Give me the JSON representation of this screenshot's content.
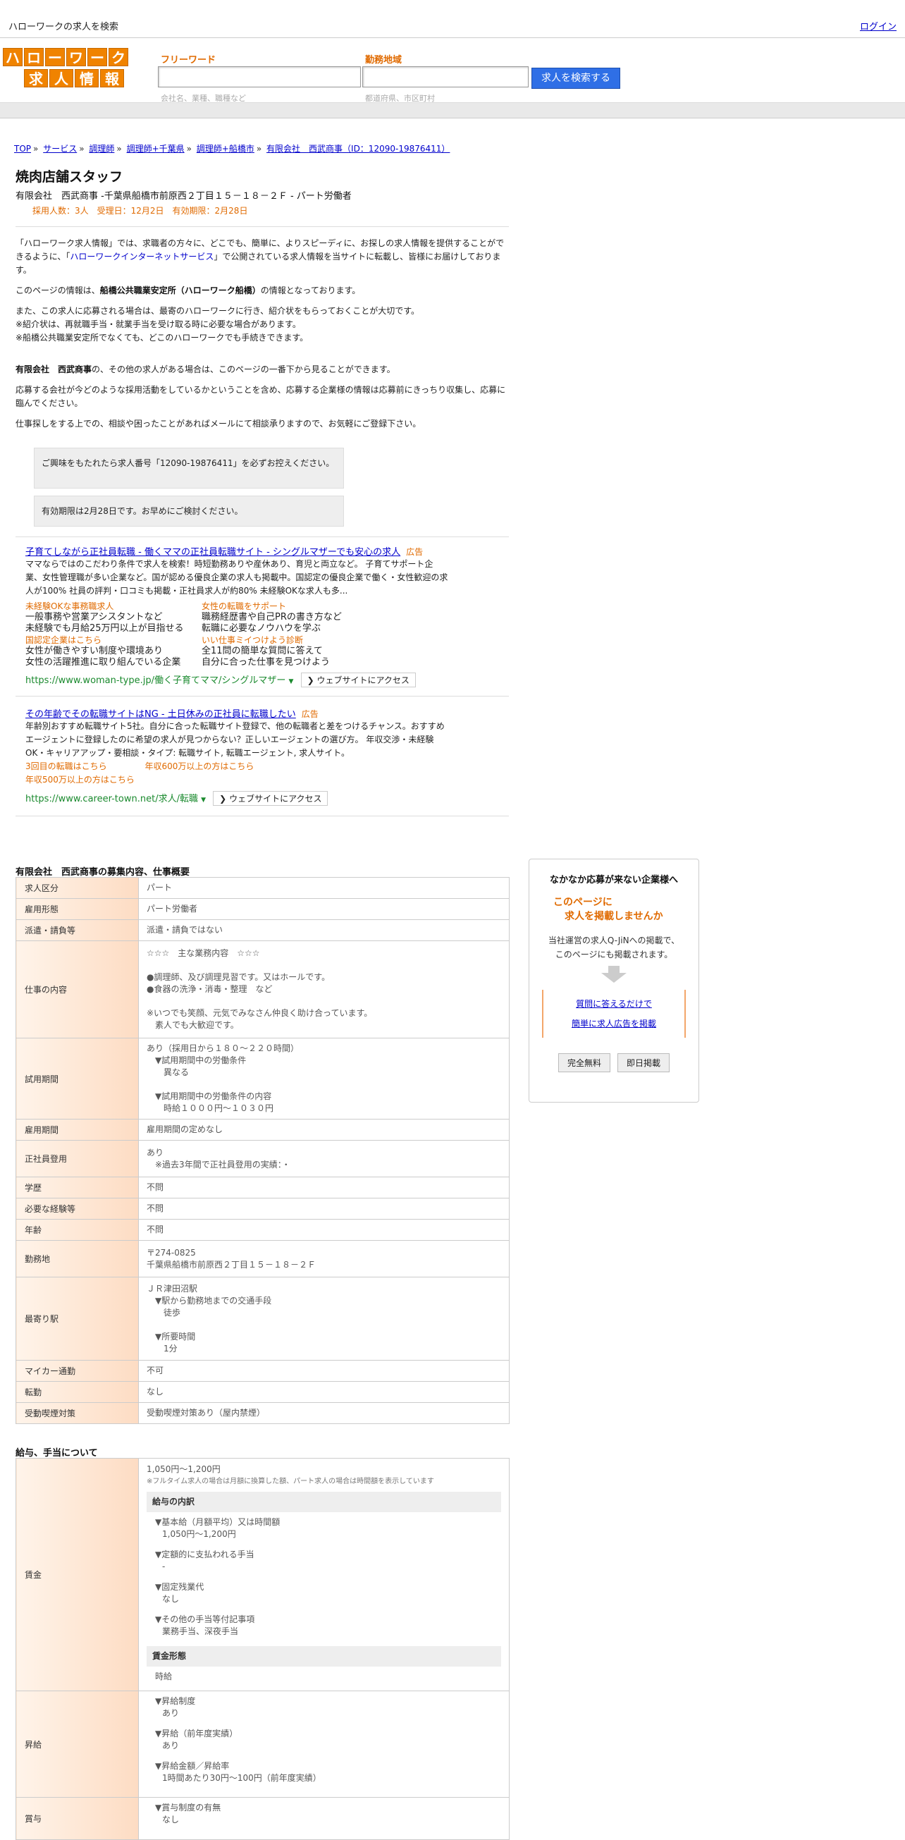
{
  "topbar": {
    "site_title": "ハローワークの求人を検索",
    "login": "ログイン"
  },
  "logo": {
    "row1": [
      "ハ",
      "ロ",
      "ー",
      "ワ",
      "ー",
      "ク"
    ],
    "row2": [
      "求",
      "人",
      "情",
      "報"
    ]
  },
  "search": {
    "free_label": "フリーワード",
    "free_placeholder": "会社名、業種、職種など",
    "area_label": "勤務地域",
    "area_placeholder": "都道府県、市区町村",
    "button": "求人を検索する"
  },
  "breadcrumb": [
    "TOP",
    "サービス",
    "調理師",
    "調理師+千葉県",
    "調理師+船橋市",
    "有限会社　西武商事（ID：12090-19876411）"
  ],
  "job": {
    "title": "焼肉店舗スタッフ",
    "subtitle": "有限会社　西武商事 -千葉県船橋市前原西２丁目１５－１８－２Ｆ - パート労働者",
    "meta": "採用人数：3人　受理日：12月2日　有効期限：2月28日"
  },
  "intro": {
    "p1a": "「ハローワーク求人情報」では、求職者の方々に、どこでも、簡単に、よりスピーディに、お探しの求人情報を提供することができるように、「",
    "p1link": "ハローワークインターネットサービス",
    "p1b": "」で公開されている求人情報を当サイトに転載し、皆様にお届けしております。",
    "p2a": "このページの情報は、",
    "p2b": "船橋公共職業安定所（ハローワーク船橋）",
    "p2c": "の情報となっております。",
    "p3": [
      "また、この求人に応募される場合は、最寄のハローワークに行き、紹介状をもらっておくことが大切です。",
      "※紹介状は、再就職手当・就業手当を受け取る時に必要な場合があります。",
      "※船橋公共職業安定所でなくても、どこのハローワークでも手続きできます。"
    ],
    "p4a": "有限会社　西武商事",
    "p4b": "の、その他の求人がある場合は、このページの一番下から見ることができます。",
    "p5": "応募する会社が今どのような採用活動をしているかということを含め、応募する企業様の情報は応募前にきっちり収集し、応募に臨んでください。",
    "p6": "仕事探しをする上での、相談や困ったことがあればメールにて相談承りますので、お気軽にご登録下さい。",
    "notice1": "ご興味をもたれたら求人番号「12090-19876411」を必ずお控えください。",
    "notice2": "有効期限は2月28日です。お早めにご検討ください。"
  },
  "ads": [
    {
      "title": "子育てしながら正社員転職 - 働くママの正社員転職サイト - シングルマザーでも安心の求人",
      "tag": "広告",
      "desc": "ママならではのこだわり条件で求人を検索！時短勤務ありや産休あり、育児と両立など。 子育てサポート企業、女性管理職が多い企業など。国が認める優良企業の求人も掲載中。国認定の優良企業で働く・女性歓迎の求人が100% 社員の評判・口コミも掲載・正社員求人が約80% 未経験OKな求人も多...",
      "links": [
        {
          "t": "未経験OKな事務職求人",
          "l1": "一般事務や営業アシスタントなど",
          "l2": "未経験でも月給25万円以上が目指せる"
        },
        {
          "t": "女性の転職をサポート",
          "l1": "職務経歴書や自己PRの書き方など",
          "l2": "転職に必要なノウハウを学ぶ"
        },
        {
          "t": "国認定企業はこちら",
          "l1": "女性が働きやすい制度や環境あり",
          "l2": "女性の活躍推進に取り組んでいる企業"
        },
        {
          "t": "いい仕事ミイつけよう診断",
          "l1": "全11問の簡単な質問に答えて",
          "l2": "自分に合った仕事を見つけよう"
        }
      ],
      "url": "https://www.woman-type.jp/働く子育てママ/シングルマザー",
      "visit": "ウェブサイトにアクセス"
    },
    {
      "title": "その年齢でその転職サイトはNG - 土日休みの正社員に転職したい",
      "tag": "広告",
      "desc": "年齢別おすすめ転職サイト5社。自分に合った転職サイト登録で、他の転職者と差をつけるチャンス。おすすめエージェントに登録したのに希望の求人が見つからない？正しいエージェントの選び方。 年収交渉・未経験OK・キャリアアップ・要相談・タイプ: 転職サイト, 転職エージェント, 求人サイト。",
      "orange": [
        "3回目の転職はこちら",
        "年収600万以上の方はこちら",
        "年収500万以上の方はこちら"
      ],
      "url": "https://www.career-town.net/求人/転職",
      "visit": "ウェブサイトにアクセス"
    }
  ],
  "table1": {
    "title": "有限会社　西武商事の募集内容、仕事概要",
    "rows": [
      {
        "k": "求人区分",
        "v": "パート"
      },
      {
        "k": "雇用形態",
        "v": "パート労働者"
      },
      {
        "k": "派遣・請負等",
        "v": "派遣・請負ではない"
      },
      {
        "k": "仕事の内容",
        "lines": [
          "☆☆☆　主な業務内容　☆☆☆",
          "",
          "●調理師、及び調理見習です。又はホールです。",
          "●食器の洗浄・消毒・整理　など",
          "",
          "※いつでも笑顔、元気でみなさん仲良く助け合っています。",
          "　素人でも大歓迎です。"
        ]
      },
      {
        "k": "試用期間",
        "lines": [
          "あり（採用日から１８０～２２０時間）",
          "　▼試用期間中の労働条件",
          "　　異なる",
          "",
          "　▼試用期間中の労働条件の内容",
          "　　時給１０００円～１０３０円"
        ]
      },
      {
        "k": "雇用期間",
        "v": "雇用期間の定めなし"
      },
      {
        "k": "正社員登用",
        "lines": [
          "あり",
          "　※過去3年間で正社員登用の実績：・"
        ]
      },
      {
        "k": "学歴",
        "v": "不問"
      },
      {
        "k": "必要な経験等",
        "v": "不問"
      },
      {
        "k": "年齢",
        "v": "不問"
      },
      {
        "k": "勤務地",
        "lines": [
          "〒274-0825",
          "千葉県船橋市前原西２丁目１５－１８－２Ｆ"
        ]
      },
      {
        "k": "最寄り駅",
        "lines": [
          "ＪＲ津田沼駅",
          "　▼駅から勤務地までの交通手段",
          "　　徒歩",
          "",
          "　▼所要時間",
          "　　1分"
        ]
      },
      {
        "k": "マイカー通勤",
        "v": "不可"
      },
      {
        "k": "転勤",
        "v": "なし"
      },
      {
        "k": "受動喫煙対策",
        "v": "受動喫煙対策あり（屋内禁煙）"
      }
    ]
  },
  "table2": {
    "title": "給与、手当について",
    "wage_key": "賃金",
    "wage_main": "1,050円〜1,200円",
    "wage_note": "※フルタイム求人の場合は月額に換算した額、パート求人の場合は時間額を表示しています",
    "wage_sub": "給与の内訳",
    "wage_items": [
      {
        "h": "▼基本給（月額平均）又は時間額",
        "v": "1,050円〜1,200円"
      },
      {
        "h": "▼定額的に支払われる手当",
        "v": "-"
      },
      {
        "h": "▼固定残業代",
        "v": "なし"
      },
      {
        "h": "▼その他の手当等付記事項",
        "v": "業務手当、深夜手当"
      }
    ],
    "wage_form_head": "賃金形態",
    "wage_form": "時給",
    "raise_key": "昇給",
    "raise_items": [
      {
        "h": "▼昇給制度",
        "v": "あり"
      },
      {
        "h": "▼昇給（前年度実績）",
        "v": "あり"
      },
      {
        "h": "▼昇給金額／昇給率",
        "v": "1時間あたり30円〜100円（前年度実績）"
      }
    ],
    "bonus_key": "賞与",
    "bonus_items": [
      {
        "h": "▼賞与制度の有無",
        "v": "なし"
      }
    ]
  },
  "sidebox": {
    "title": "なかなか応募が来ない企業様へ",
    "headline1": "このページに",
    "headline2": "求人を掲載しませんか",
    "desc1": "当社運営の求人Q-JiNへの掲載で、",
    "desc2": "このページにも掲載されます。",
    "link1": "質問に答えるだけで",
    "link2": "簡単に求人広告を掲載",
    "btn1": "完全無料",
    "btn2": "即日掲載"
  }
}
